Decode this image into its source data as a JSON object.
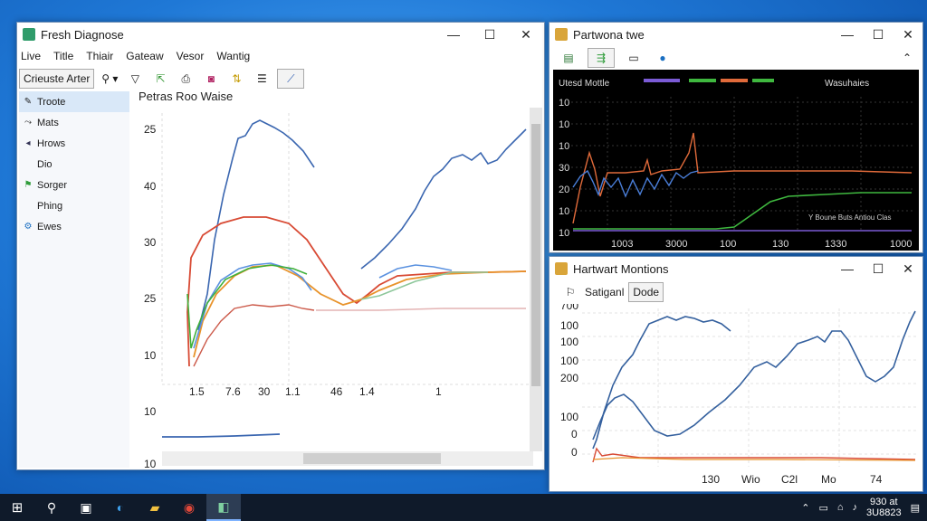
{
  "main_window": {
    "title": "Fresh Diagnose",
    "menu": [
      "Live",
      "Title",
      "Thiair",
      "Gateaw",
      "Vesor",
      "Wantig"
    ],
    "toolbar": {
      "dropdown_label": "Crieuste Arter",
      "icons": [
        "search-icon",
        "filter-icon",
        "export-icon",
        "print-icon",
        "camera-icon",
        "sort-icon",
        "list-icon",
        "chart-icon"
      ]
    },
    "sidebar": [
      {
        "label": "Troote",
        "icon": "pin-icon",
        "selected": true
      },
      {
        "label": "Mats",
        "icon": "arrow-icon",
        "selected": false
      },
      {
        "label": "Hrows",
        "icon": "flag-icon",
        "selected": false
      },
      {
        "label": "Dio",
        "icon": "",
        "selected": false
      },
      {
        "label": "Sorger",
        "icon": "green-flag-icon",
        "selected": false
      },
      {
        "label": "Phing",
        "icon": "",
        "selected": false
      },
      {
        "label": "Ewes",
        "icon": "gear-icon",
        "selected": false
      }
    ],
    "chart_title": "Petras Roo Waise",
    "y_ticks": [
      "25",
      "40",
      "30",
      "25",
      "10",
      "10",
      "10"
    ],
    "x_ticks": [
      "1.5",
      "7.6",
      "30",
      "1.1",
      "46",
      "1.4",
      "1"
    ]
  },
  "right_top_window": {
    "title": "Partwona twe",
    "chart_header": "Utesd Mottle",
    "legend_right": "Wasuhaies",
    "y_ticks": [
      "10",
      "10",
      "10",
      "30",
      "20",
      "10",
      "10"
    ],
    "x_ticks": [
      "1003",
      "3000",
      "100",
      "130",
      "1330",
      "1000"
    ],
    "annotation": "Y Boune Buts Antiou Clas",
    "colors": {
      "bg": "#000000",
      "orange": "#e06a3a",
      "blue": "#4a7ed8",
      "green": "#3fb83f",
      "purple": "#7b5bd6"
    }
  },
  "right_bottom_window": {
    "title": "Hartwart Montions",
    "toolbar_labels": [
      "Satiganl",
      "Dode"
    ],
    "y_ticks": [
      "700",
      "100",
      "100",
      "100",
      "200",
      "100",
      "0",
      "0"
    ],
    "x_ticks": [
      "130",
      "Wio",
      "C2l",
      "Mo",
      "74"
    ]
  },
  "taskbar": {
    "items": [
      "windows-icon",
      "search-icon",
      "task-view-icon",
      "edge-icon",
      "folder-icon",
      "chrome-icon",
      "app-icon"
    ],
    "time": "930 at",
    "date": "3U8823"
  }
}
